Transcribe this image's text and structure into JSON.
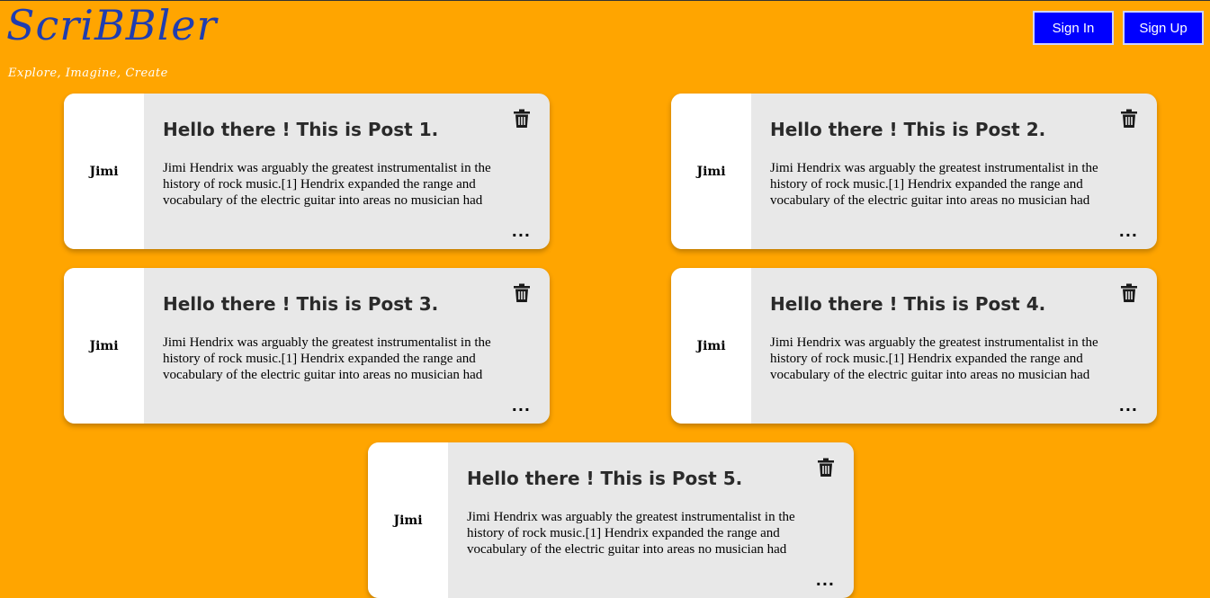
{
  "header": {
    "brand": "ScriBBler",
    "tagline": "Explore, Imagine, Create",
    "sign_in_label": "Sign In",
    "sign_up_label": "Sign Up"
  },
  "colors": {
    "background": "#FFA500",
    "brand": "#1f3db0",
    "button": "#0000ff",
    "card": "#e8e8e8"
  },
  "posts": [
    {
      "author": "Jimi",
      "title": "Hello there ! This is Post 1.",
      "excerpt": "Jimi Hendrix was arguably the greatest instrumentalist in the history of rock music.[1] Hendrix expanded the range and vocabulary of the electric guitar into areas no musician had",
      "delete_icon": "trash-icon",
      "more_label": "..."
    },
    {
      "author": "Jimi",
      "title": "Hello there ! This is Post 2.",
      "excerpt": "Jimi Hendrix was arguably the greatest instrumentalist in the history of rock music.[1] Hendrix expanded the range and vocabulary of the electric guitar into areas no musician had",
      "delete_icon": "trash-icon",
      "more_label": "..."
    },
    {
      "author": "Jimi",
      "title": "Hello there ! This is Post 3.",
      "excerpt": "Jimi Hendrix was arguably the greatest instrumentalist in the history of rock music.[1] Hendrix expanded the range and vocabulary of the electric guitar into areas no musician had",
      "delete_icon": "trash-icon",
      "more_label": "..."
    },
    {
      "author": "Jimi",
      "title": "Hello there ! This is Post 4.",
      "excerpt": "Jimi Hendrix was arguably the greatest instrumentalist in the history of rock music.[1] Hendrix expanded the range and vocabulary of the electric guitar into areas no musician had",
      "delete_icon": "trash-icon",
      "more_label": "..."
    },
    {
      "author": "Jimi",
      "title": "Hello there ! This is Post 5.",
      "excerpt": "Jimi Hendrix was arguably the greatest instrumentalist in the history of rock music.[1] Hendrix expanded the range and vocabulary of the electric guitar into areas no musician had",
      "delete_icon": "trash-icon",
      "more_label": "..."
    }
  ]
}
